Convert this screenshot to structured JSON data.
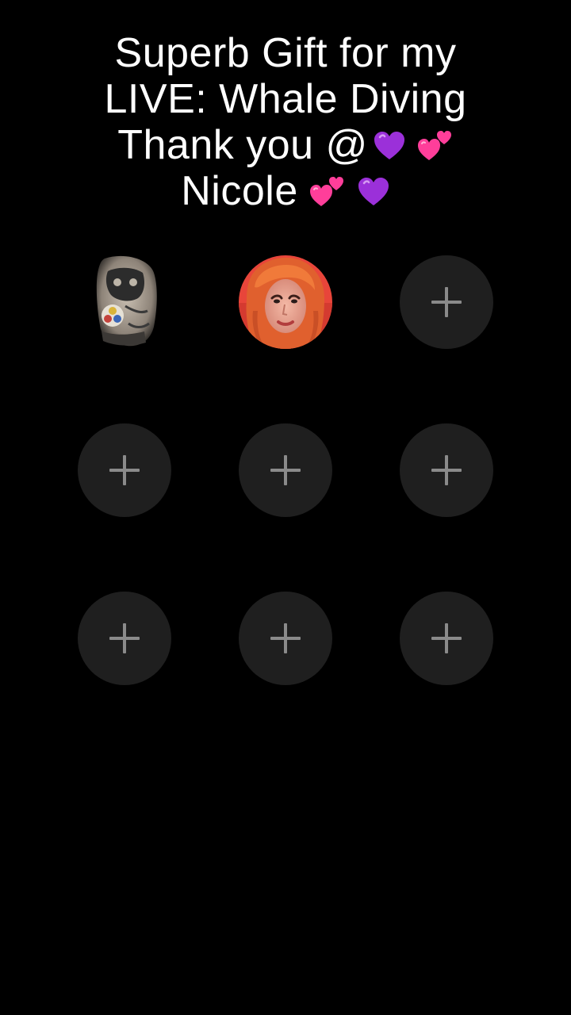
{
  "caption": {
    "line1": "Superb Gift for my",
    "line2": "LIVE: Whale Diving",
    "line3": "Thank you @",
    "line4": "Nicole",
    "emoji_colors": {
      "purple_heart": "#9b30d9",
      "two_hearts": "#ff3e9a"
    }
  },
  "grid": {
    "rows": 3,
    "cols": 3,
    "filled_avatars": [
      "tattoo-arm-avatar",
      "red-hair-woman-avatar"
    ],
    "empty_slot_icon": "plus-icon",
    "slot_color": "#1f1f1f",
    "plus_color": "#8a8a8a"
  }
}
